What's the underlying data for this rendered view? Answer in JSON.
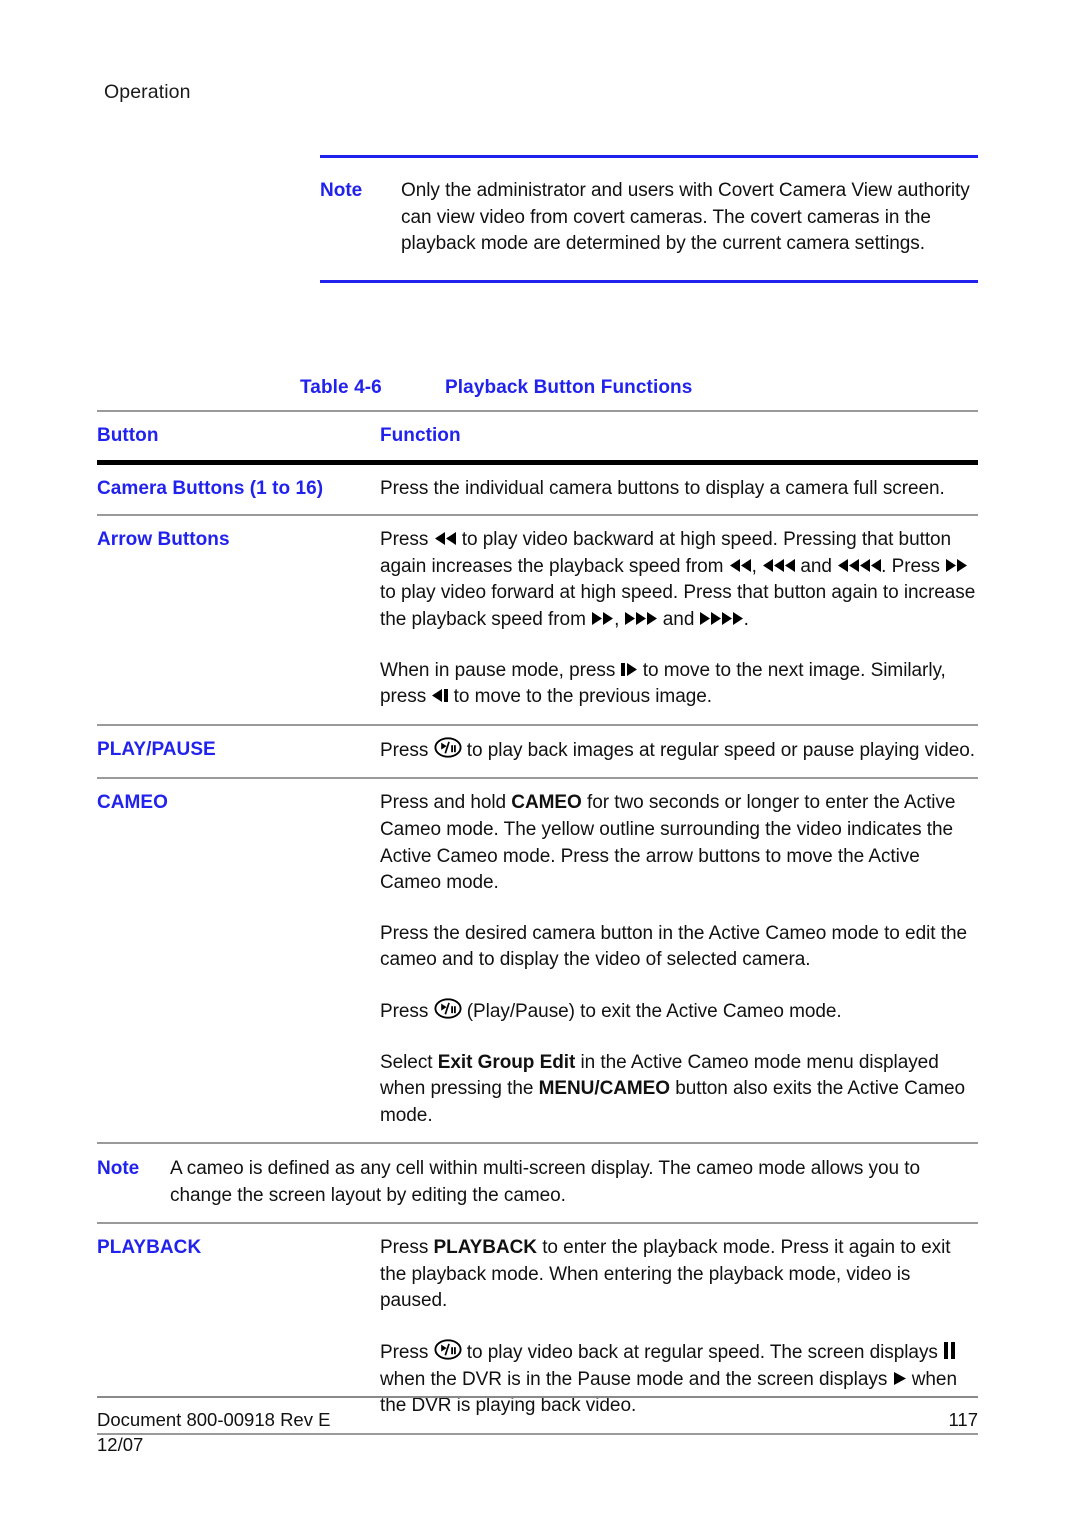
{
  "running_head": "Operation",
  "top_note": {
    "label": "Note",
    "text": "Only the administrator and users with Covert Camera View authority can view video from covert cameras. The covert cameras in the playback mode are determined by the current camera settings."
  },
  "table": {
    "caption_number": "Table  4-6",
    "caption_title": "Playback Button Functions",
    "header": {
      "button": "Button",
      "function": "Function"
    },
    "rows": [
      {
        "button": "Camera Buttons (1 to 16)",
        "paragraphs": [
          "Press the individual camera buttons to display a camera full screen."
        ]
      },
      {
        "button": "Arrow Buttons",
        "paragraphs": [
          "Press [rewind-2] to play video backward at high speed. Pressing that button again increases the playback speed from [rewind-2], [rewind-3] and [rewind-4]. Press [fastforward-2] to play video forward at high speed. Press that button again to increase the playback speed from [fastforward-2], [fastforward-3] and [fastforward-4].",
          "When in pause mode, press [step-forward] to move to the next image. Similarly, press [step-backward] to move to the previous image."
        ]
      },
      {
        "button": "PLAY/PAUSE",
        "paragraphs": [
          "Press [play-pause] to play back images at regular speed or pause playing video."
        ]
      },
      {
        "button": "CAMEO",
        "paragraphs": [
          "Press and hold CAMEO for two seconds or longer to enter the Active Cameo mode. The yellow outline surrounding the video indicates the Active Cameo mode. Press the arrow buttons to move the Active Cameo mode.",
          "Press the desired camera button in the Active Cameo mode to edit the cameo and to display the video of selected camera.",
          "Press [play-pause] (Play/Pause) to exit the Active Cameo mode.",
          "Select Exit Group Edit in the Active Cameo mode menu displayed when pressing the MENU/CAMEO button also exits the Active Cameo mode."
        ]
      }
    ],
    "inline_note": {
      "label": "Note",
      "text": "A cameo is defined as any cell within multi-screen display. The cameo mode allows you to change the screen layout by editing the cameo."
    },
    "last_row": {
      "button": "PLAYBACK",
      "paragraphs": [
        "Press PLAYBACK to enter the playback mode. Press it again to exit the playback mode. When entering the playback mode, video is paused.",
        "Press [play-pause] to play video back at regular speed. The screen displays [pause-bars] when the DVR is in the Pause mode and the screen displays [play-triangle] when the DVR is playing back video."
      ]
    }
  },
  "footer": {
    "document": "Document 800-00918 Rev E",
    "date": "12/07",
    "page_number": "117"
  },
  "colors": {
    "accent_blue": "#2222ee",
    "rule_gray": "#9a9a9a",
    "rule_black": "#000000",
    "text": "#111111"
  },
  "inline_text": {
    "arrow_r1_a": "Press ",
    "arrow_r1_b": " to play video backward at high speed. Pressing that button again increases the playback speed from ",
    "arrow_r1_c": ", ",
    "arrow_r1_d": " and ",
    "arrow_r1_e": ". Press ",
    "arrow_r1_f": " to play video forward at high speed. Press that button again to increase the playback speed from ",
    "arrow_r1_g": ", ",
    "arrow_r1_h": " and ",
    "arrow_r1_i": ".",
    "arrow_r2_a": "When in pause mode, press ",
    "arrow_r2_b": " to move to the next image. Similarly, press ",
    "arrow_r2_c": " to move to the previous image.",
    "pp_a": "Press ",
    "pp_b": " to play back images at regular speed or pause playing video.",
    "cameo_p1_a": "Press and hold ",
    "cameo_p1_bold": "CAMEO",
    "cameo_p1_b": " for two seconds or longer to enter the Active Cameo mode. The yellow outline surrounding the video indicates the Active Cameo mode. Press the arrow buttons to move the Active Cameo mode.",
    "cameo_p2": "Press the desired camera button in the Active Cameo mode to edit the cameo and to display the video of selected camera.",
    "cameo_p3_a": "Press ",
    "cameo_p3_b": " (Play/Pause) to exit the Active Cameo mode.",
    "cameo_p4_a": "Select ",
    "cameo_p4_bold1": "Exit Group Edit",
    "cameo_p4_b": " in the Active Cameo mode menu displayed when pressing the ",
    "cameo_p4_bold2": "MENU/CAMEO",
    "cameo_p4_c": " button also exits the Active Cameo mode.",
    "pb_p1_a": "Press ",
    "pb_p1_bold": "PLAYBACK",
    "pb_p1_b": " to enter the playback mode. Press it again to exit the playback mode. When entering the playback mode, video is paused.",
    "pb_p2_a": "Press ",
    "pb_p2_b": " to play video back at regular speed. The screen displays ",
    "pb_p2_c": " when the DVR is in the Pause mode and the screen displays ",
    "pb_p2_d": " when the DVR is playing back video."
  },
  "icons": {
    "rewind_2": "rewind-double-icon",
    "rewind_3": "rewind-triple-icon",
    "rewind_4": "rewind-quad-icon",
    "forward_2": "fastforward-double-icon",
    "forward_3": "fastforward-triple-icon",
    "forward_4": "fastforward-quad-icon",
    "step_forward": "step-forward-icon",
    "step_backward": "step-backward-icon",
    "play_pause": "play-pause-circle-icon",
    "pause_bars": "pause-bars-icon",
    "play_triangle": "play-triangle-icon"
  }
}
